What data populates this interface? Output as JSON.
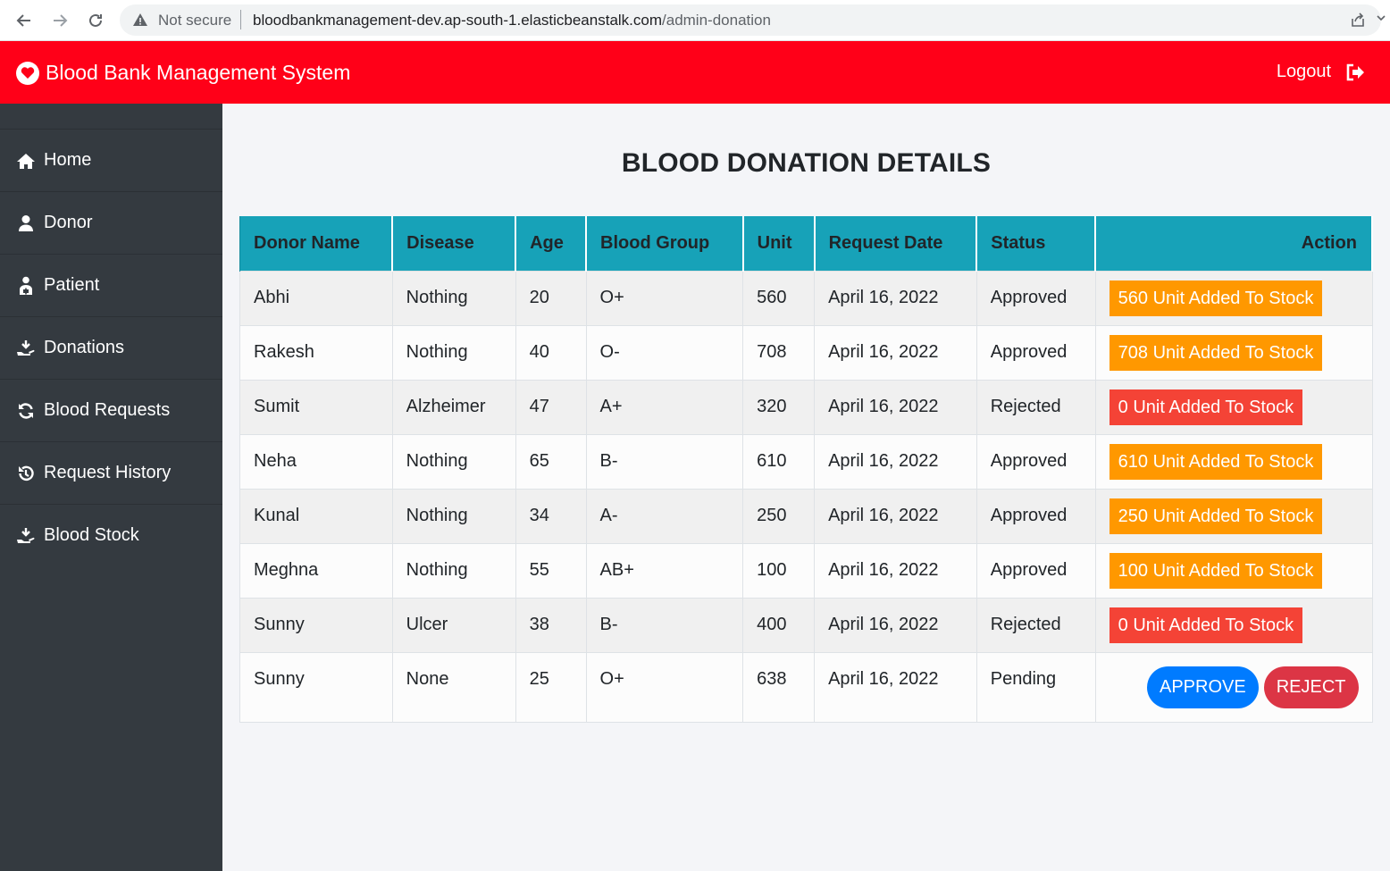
{
  "browser": {
    "security_label": "Not secure",
    "url_host": "bloodbankmanagement-dev.ap-south-1.elasticbeanstalk.com",
    "url_path": "/admin-donation"
  },
  "header": {
    "title": "Blood Bank Management System",
    "logout_label": "Logout",
    "bg_color": "#ff0018"
  },
  "sidebar": {
    "items": [
      {
        "label": "Home",
        "icon": "home-icon"
      },
      {
        "label": "Donor",
        "icon": "user-icon"
      },
      {
        "label": "Patient",
        "icon": "patient-icon"
      },
      {
        "label": "Donations",
        "icon": "hand-holding-icon"
      },
      {
        "label": "Blood Requests",
        "icon": "sync-icon"
      },
      {
        "label": "Request History",
        "icon": "history-icon"
      },
      {
        "label": "Blood Stock",
        "icon": "hand-holding-icon"
      }
    ]
  },
  "main": {
    "title": "BLOOD DONATION DETAILS",
    "columns": [
      "Donor Name",
      "Disease",
      "Age",
      "Blood Group",
      "Unit",
      "Request Date",
      "Status",
      "Action"
    ],
    "rows": [
      {
        "name": "Abhi",
        "disease": "Nothing",
        "age": "20",
        "group": "O+",
        "unit": "560",
        "date": "April 16, 2022",
        "status": "Approved",
        "action": "560 Unit Added To Stock"
      },
      {
        "name": "Rakesh",
        "disease": "Nothing",
        "age": "40",
        "group": "O-",
        "unit": "708",
        "date": "April 16, 2022",
        "status": "Approved",
        "action": "708 Unit Added To Stock"
      },
      {
        "name": "Sumit",
        "disease": "Alzheimer",
        "age": "47",
        "group": "A+",
        "unit": "320",
        "date": "April 16, 2022",
        "status": "Rejected",
        "action": "0 Unit Added To Stock"
      },
      {
        "name": "Neha",
        "disease": "Nothing",
        "age": "65",
        "group": "B-",
        "unit": "610",
        "date": "April 16, 2022",
        "status": "Approved",
        "action": "610 Unit Added To Stock"
      },
      {
        "name": "Kunal",
        "disease": "Nothing",
        "age": "34",
        "group": "A-",
        "unit": "250",
        "date": "April 16, 2022",
        "status": "Approved",
        "action": "250 Unit Added To Stock"
      },
      {
        "name": "Meghna",
        "disease": "Nothing",
        "age": "55",
        "group": "AB+",
        "unit": "100",
        "date": "April 16, 2022",
        "status": "Approved",
        "action": "100 Unit Added To Stock"
      },
      {
        "name": "Sunny",
        "disease": "Ulcer",
        "age": "38",
        "group": "B-",
        "unit": "400",
        "date": "April 16, 2022",
        "status": "Rejected",
        "action": "0 Unit Added To Stock"
      },
      {
        "name": "Sunny",
        "disease": "None",
        "age": "25",
        "group": "O+",
        "unit": "638",
        "date": "April 16, 2022",
        "status": "Pending",
        "approve_label": "APPROVE",
        "reject_label": "REJECT"
      }
    ]
  },
  "colors": {
    "header": "#ff0018",
    "sidebar": "#343a40",
    "table_header": "#17a2b8",
    "approved_badge": "#ff9800",
    "rejected_badge": "#f44336",
    "approve_button": "#007bff",
    "reject_button": "#dc3545"
  }
}
